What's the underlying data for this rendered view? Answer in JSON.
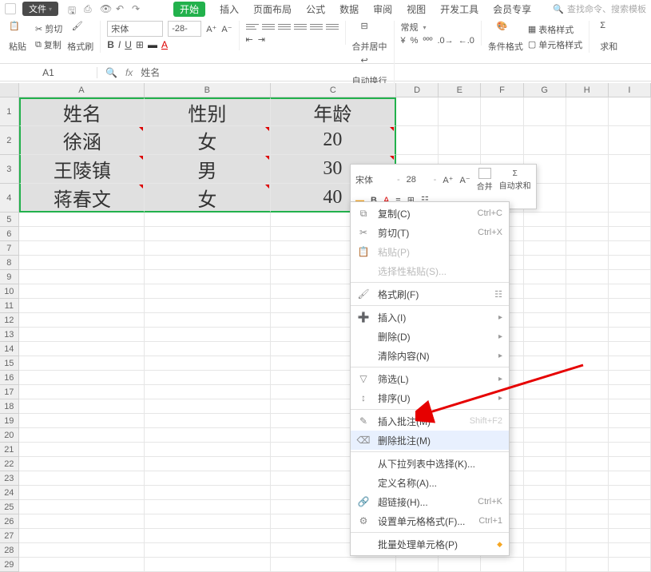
{
  "top": {
    "file": "文件",
    "tabs": [
      "开始",
      "插入",
      "页面布局",
      "公式",
      "数据",
      "审阅",
      "视图",
      "开发工具",
      "会员专享"
    ],
    "active_tab": 0,
    "search_placeholder": "查找命令、搜索模板"
  },
  "ribbon": {
    "paste": "粘贴",
    "cut": "剪切",
    "copy": "复制",
    "format_painter": "格式刷",
    "font_name": "宋体",
    "font_size": "28",
    "merge_center": "合并居中",
    "wrap_text": "自动换行",
    "general": "常规",
    "currency_symbol": "¥",
    "cond_fmt": "条件格式",
    "table_style": "表格样式",
    "cell_style": "单元格样式",
    "sum": "求和"
  },
  "formula_bar": {
    "name_box": "A1",
    "content": "姓名"
  },
  "grid": {
    "columns": [
      "A",
      "B",
      "C",
      "D",
      "E",
      "F",
      "G",
      "H",
      "I"
    ],
    "data_rows": [
      {
        "n": "1",
        "cells": [
          "姓名",
          "性别",
          "年龄"
        ]
      },
      {
        "n": "2",
        "cells": [
          "徐涵",
          "女",
          "20"
        ]
      },
      {
        "n": "3",
        "cells": [
          "王陵镇",
          "男",
          "30"
        ]
      },
      {
        "n": "4",
        "cells": [
          "蒋春文",
          "女",
          "40"
        ]
      }
    ],
    "empty_start": 5,
    "empty_end": 29
  },
  "mini_toolbar": {
    "font_name": "宋体",
    "font_size": "28",
    "merge": "合并",
    "autosum": "自动求和"
  },
  "context_menu": {
    "items": [
      {
        "icon": "⧉",
        "label": "复制(C)",
        "shortcut": "Ctrl+C",
        "type": "item"
      },
      {
        "icon": "✂",
        "label": "剪切(T)",
        "shortcut": "Ctrl+X",
        "type": "item"
      },
      {
        "icon": "📋",
        "label": "粘贴(P)",
        "shortcut": "",
        "type": "item",
        "disabled": true
      },
      {
        "icon": "",
        "label": "选择性粘贴(S)...",
        "shortcut": "",
        "type": "item",
        "disabled": true
      },
      {
        "type": "sep"
      },
      {
        "icon": "🖌",
        "label": "格式刷(F)",
        "shortcut": "",
        "type": "item",
        "extra": "☷"
      },
      {
        "type": "sep"
      },
      {
        "icon": "➕",
        "label": "插入(I)",
        "shortcut": "",
        "type": "submenu"
      },
      {
        "icon": "",
        "label": "删除(D)",
        "shortcut": "",
        "type": "submenu"
      },
      {
        "icon": "",
        "label": "清除内容(N)",
        "shortcut": "",
        "type": "submenu"
      },
      {
        "type": "sep"
      },
      {
        "icon": "▽",
        "label": "筛选(L)",
        "shortcut": "",
        "type": "submenu"
      },
      {
        "icon": "↕",
        "label": "排序(U)",
        "shortcut": "",
        "type": "submenu"
      },
      {
        "type": "sep"
      },
      {
        "icon": "✎",
        "label": "插入批注(M)",
        "shortcut": "Shift+F2",
        "type": "item",
        "shortcut_faded": true
      },
      {
        "icon": "⌫",
        "label": "删除批注(M)",
        "shortcut": "",
        "type": "item",
        "highlight": true
      },
      {
        "type": "sep"
      },
      {
        "icon": "",
        "label": "从下拉列表中选择(K)...",
        "shortcut": "",
        "type": "item"
      },
      {
        "icon": "",
        "label": "定义名称(A)...",
        "shortcut": "",
        "type": "item"
      },
      {
        "icon": "🔗",
        "label": "超链接(H)...",
        "shortcut": "Ctrl+K",
        "type": "item"
      },
      {
        "icon": "⚙",
        "label": "设置单元格格式(F)...",
        "shortcut": "Ctrl+1",
        "type": "item"
      },
      {
        "type": "sep"
      },
      {
        "icon": "",
        "label": "批量处理单元格(P)",
        "shortcut": "",
        "type": "item",
        "gold": true
      }
    ]
  }
}
